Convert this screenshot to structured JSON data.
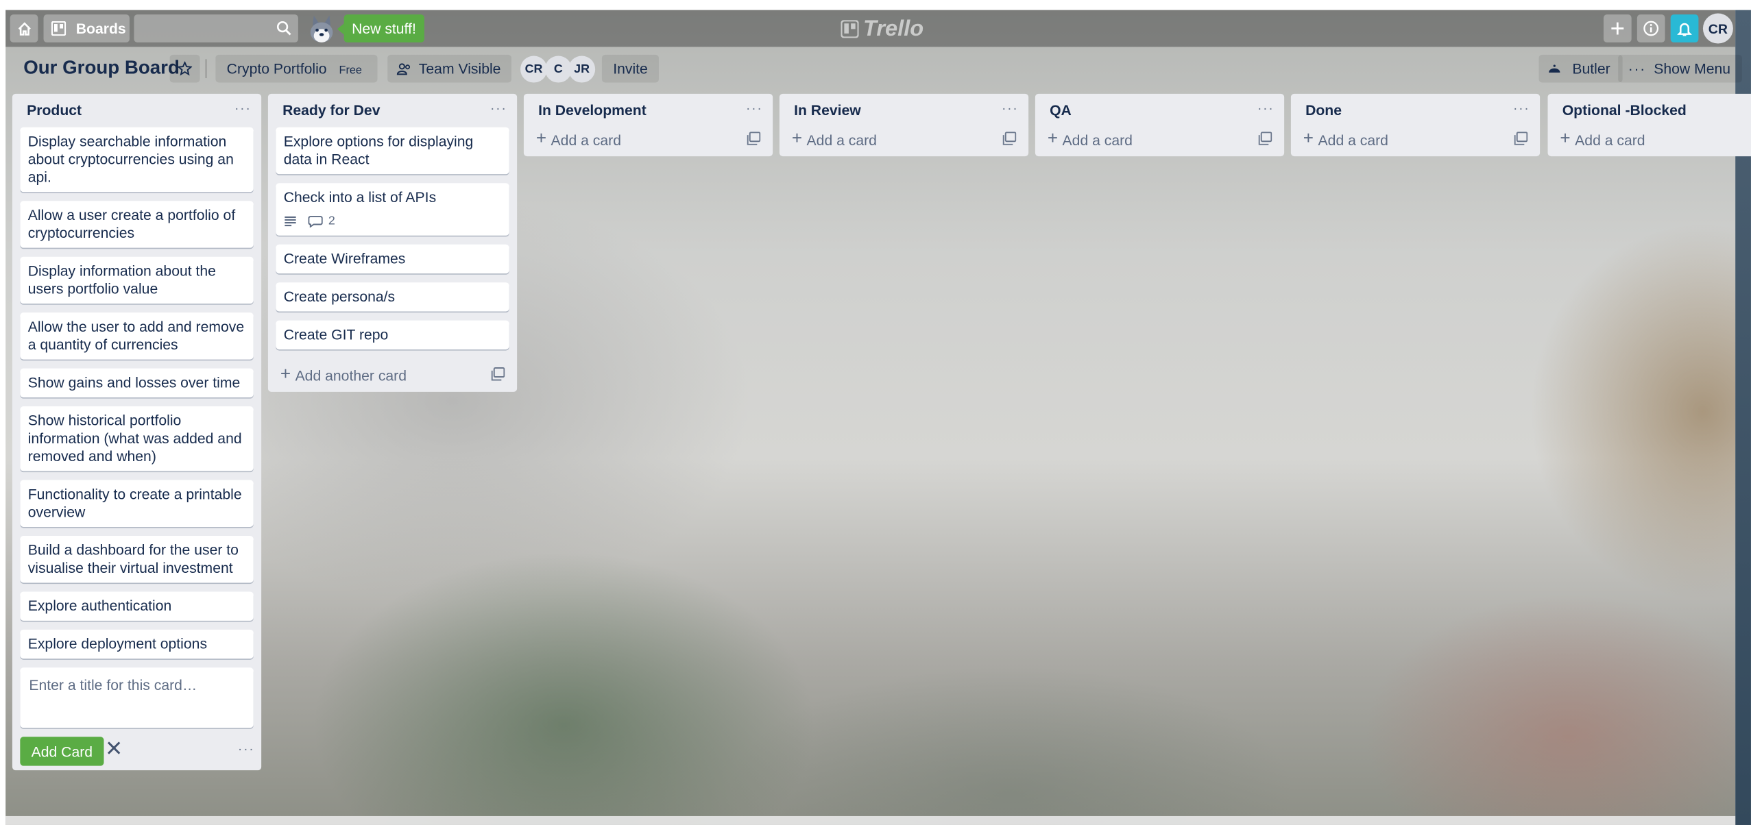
{
  "header": {
    "boards_label": "Boards",
    "new_stuff_label": "New stuff!",
    "logo_text": "Trello",
    "user_initials": "CR"
  },
  "board": {
    "title": "Our Group Board",
    "team_name": "Crypto Portfolio",
    "team_plan": "Free",
    "visibility_label": "Team Visible",
    "members": [
      "CR",
      "C",
      "JR"
    ],
    "invite_label": "Invite",
    "butler_label": "Butler",
    "show_menu_label": "Show Menu"
  },
  "lists": [
    {
      "name": "Product",
      "cards": [
        "Display searchable information about cryptocurrencies using an api.",
        "Allow a user create a portfolio of cryptocurrencies",
        "Display information about the users portfolio value",
        "Allow the user to add and remove a quantity of currencies",
        "Show gains and losses over time",
        "Show historical portfolio information (what was added and removed and when)",
        "Functionality to create a printable overview",
        "Build a dashboard for the user to visualise their virtual investment",
        "Explore authentication",
        "Explore deployment options"
      ],
      "composer_placeholder": "Enter a title for this card…",
      "add_card_button": "Add Card"
    },
    {
      "name": "Ready for Dev",
      "cards": [
        "Explore options for displaying data in React",
        "Check into a list of APIs",
        "Create Wireframes",
        "Create persona/s",
        "Create GIT repo"
      ],
      "card_badge_comments": "2",
      "add_label": "Add another card"
    },
    {
      "name": "In Development",
      "add_label": "Add a card"
    },
    {
      "name": "In Review",
      "add_label": "Add a card"
    },
    {
      "name": "QA",
      "add_label": "Add a card"
    },
    {
      "name": "Done",
      "add_label": "Add a card"
    },
    {
      "name": "Optional -Blocked",
      "add_label": "Add a card"
    }
  ],
  "colors": {
    "accent_green": "#5aac44",
    "notification_blue": "#29b9d5",
    "list_bg": "#ebecf0"
  }
}
